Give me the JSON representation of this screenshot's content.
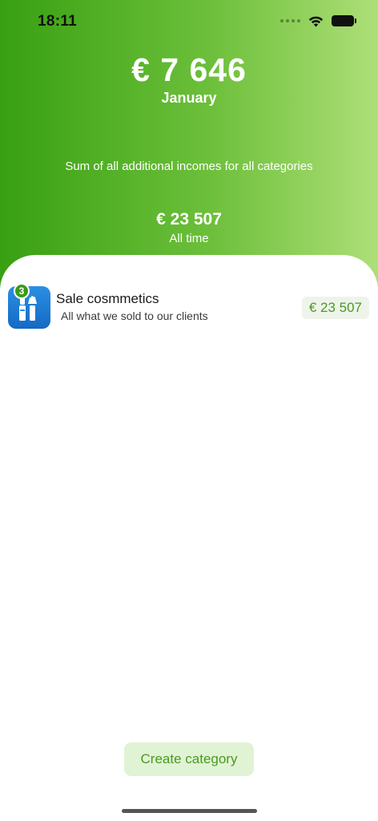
{
  "status_bar": {
    "time": "18:11",
    "icons": [
      "signal-dots-icon",
      "wifi-icon",
      "battery-icon"
    ]
  },
  "summary": {
    "month_amount": "€ 7 646",
    "month_label": "January",
    "description": "Sum of all additional incomes for all categories",
    "alltime_amount": "€ 23 507",
    "alltime_label": "All time"
  },
  "categories": [
    {
      "icon": "cosmetics-icon",
      "badge": "3",
      "name": "Sale cosmmetics",
      "description": "All what we sold to our clients",
      "amount": "€  23 507"
    }
  ],
  "actions": {
    "create_category": "Create category"
  },
  "colors": {
    "gradient_start": "#38a012",
    "gradient_end": "#aedf78",
    "accent_green": "#4a9a22",
    "icon_blue": "#1f7fd6",
    "button_bg": "#e0f3d4"
  }
}
